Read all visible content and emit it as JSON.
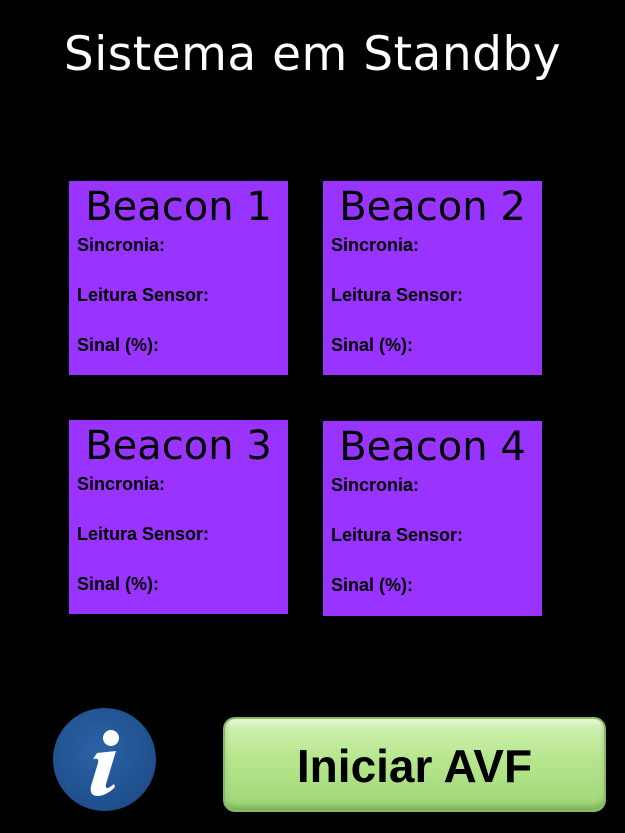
{
  "screen": {
    "title": "Sistema em Standby"
  },
  "beacons": [
    {
      "name": "Beacon 1",
      "sync_label": "Sincronia:",
      "sensor_label": "Leitura Sensor:",
      "signal_label": "Sinal (%):"
    },
    {
      "name": "Beacon 2",
      "sync_label": "Sincronia:",
      "sensor_label": "Leitura Sensor:",
      "signal_label": "Sinal (%):"
    },
    {
      "name": "Beacon 3",
      "sync_label": "Sincronia:",
      "sensor_label": "Leitura Sensor:",
      "signal_label": "Sinal (%):"
    },
    {
      "name": "Beacon 4",
      "sync_label": "Sincronia:",
      "sensor_label": "Leitura Sensor:",
      "signal_label": "Sinal (%):"
    }
  ],
  "actions": {
    "info_icon": "info-icon",
    "start_label": "Iniciar AVF"
  },
  "colors": {
    "background": "#000000",
    "card": "#9933ff",
    "info_button": "#1f4f8c",
    "start_button": "#b6e68c"
  }
}
